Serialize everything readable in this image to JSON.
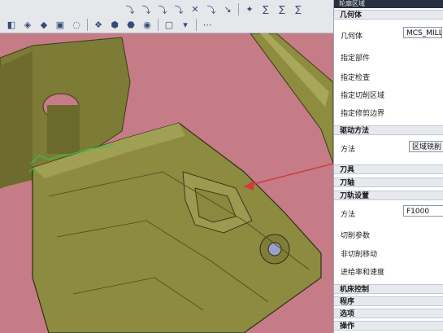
{
  "panel": {
    "window_title": "轮廓区域",
    "sections": {
      "geometry": "几何体",
      "drive": "驱动方法",
      "tool": "刀具",
      "tool_axis": "刀轴",
      "toolpath_settings": "刀轨设置",
      "machine_control": "机床控制",
      "program": "程序",
      "options": "选项",
      "actions": "操作"
    },
    "geometry_label": "几何体",
    "geometry_value": "MCS_MILL",
    "specify_part": "指定部件",
    "specify_check": "指定检查",
    "specify_cut_area": "指定切削区域",
    "specify_trim_boundary": "指定修剪边界",
    "drive_method_label": "方法",
    "drive_method_value": "区域铣削",
    "toolpath_method_label": "方法",
    "toolpath_method_value": "F1000",
    "cut_params": "切削参数",
    "non_cut_moves": "非切削移动",
    "feeds_speeds": "进给率和速度"
  },
  "toolbar": {
    "icons": [
      "select-icon",
      "filter-icon",
      "layer-icon",
      "snap-icon",
      "view-icon",
      "shade-icon",
      "wire-icon",
      "box-icon",
      "arrow-icon",
      "tool-icon",
      "tool-icon",
      "tool-icon",
      "tool-icon",
      "tool-icon",
      "tool-icon",
      "tool-icon",
      "tool-icon",
      "tool-icon"
    ]
  },
  "colors": {
    "background": "#c57c86",
    "part": "#8a8a3c",
    "part_dark": "#5e5e26",
    "arrow": "#d23a3a",
    "panel_title": "#2a2f3f"
  }
}
